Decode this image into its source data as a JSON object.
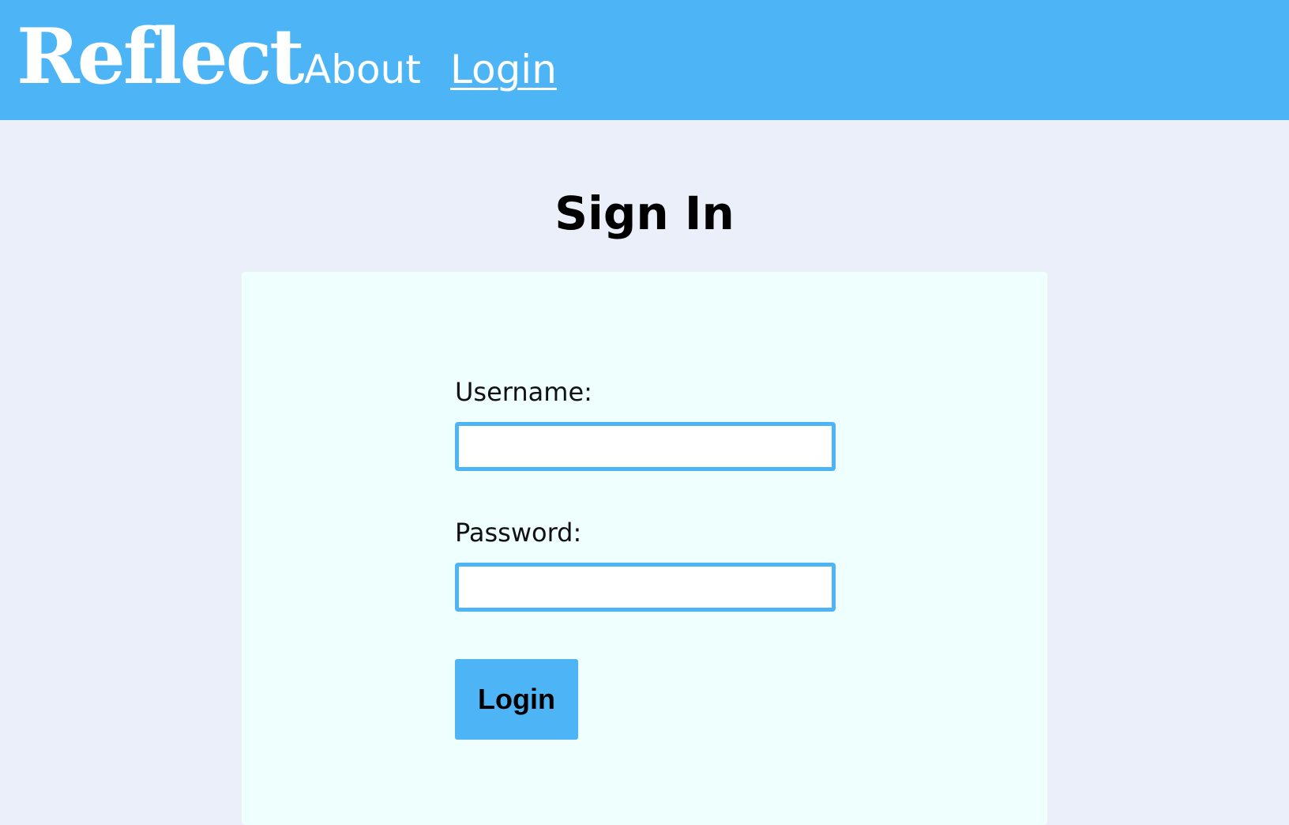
{
  "header": {
    "brand": "Reflect",
    "nav": {
      "about": "About",
      "login": "Login"
    }
  },
  "main": {
    "title": "Sign In",
    "form": {
      "username_label": "Username:",
      "username_value": "",
      "password_label": "Password:",
      "password_value": "",
      "submit_label": "Login"
    }
  },
  "colors": {
    "accent": "#4db5f5",
    "page_background": "#ebeff9",
    "card_background": "#eefffe"
  }
}
